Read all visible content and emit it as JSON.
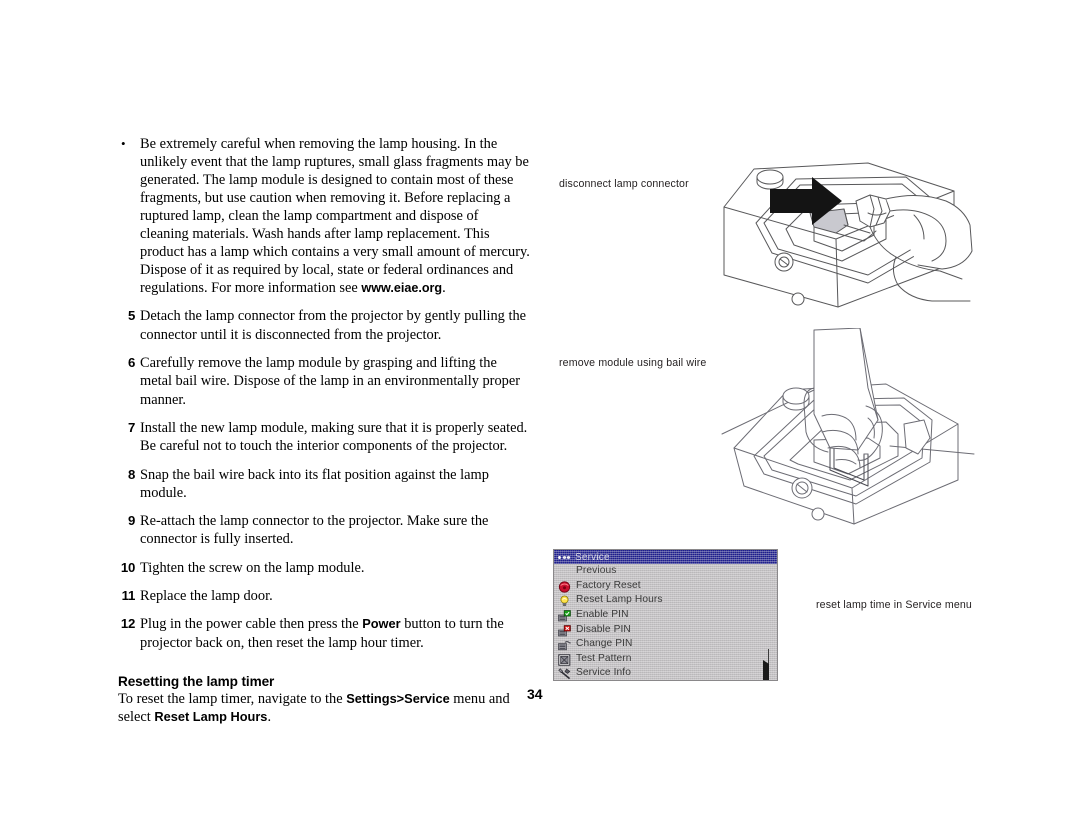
{
  "page": {
    "number": "34"
  },
  "body": {
    "bullet": {
      "marker": "•",
      "text_before_link": "Be extremely careful when removing the lamp housing. In the unlikely event that the lamp ruptures, small glass fragments may be generated. The lamp module is designed to contain most of these fragments, but use caution when removing it. Before replacing a ruptured lamp, clean the lamp compartment and dispose of cleaning materials. Wash hands after lamp replacement. This product has a lamp which contains a very small amount of mercury. Dispose of it as required by local, state or federal ordinances and regulations. For more information see ",
      "link_text": "www.eiae.org",
      "text_after_link": "."
    },
    "steps": [
      {
        "number": "5",
        "text": "Detach the lamp connector from the projector by gently pulling the connector until it is disconnected from the projector."
      },
      {
        "number": "6",
        "text": "Carefully remove the lamp module by grasping and lifting the metal bail wire. Dispose of the lamp in an environmentally proper manner."
      },
      {
        "number": "7",
        "text": "Install the new lamp module, making sure that it is properly seated. Be careful not to touch the interior components of the projector."
      },
      {
        "number": "8",
        "text": "Snap the bail wire back into its flat position against the lamp module."
      },
      {
        "number": "9",
        "text": "Re-attach the lamp connector to the projector. Make sure the connector is fully inserted."
      },
      {
        "number": "10",
        "text": "Tighten the screw on the lamp module."
      },
      {
        "number": "11",
        "text": "Replace the lamp door."
      },
      {
        "number": "12",
        "text_part1": "Plug in the power cable then press the ",
        "bold": "Power",
        "text_part2": " button to turn the projector back on, then reset the lamp hour timer."
      }
    ],
    "section": {
      "heading": "Resetting the lamp timer",
      "sentence_part1": "To reset the lamp timer, navigate to the ",
      "bold1": "Settings>Service",
      "sentence_part2": " menu and select ",
      "bold2": "Reset Lamp Hours",
      "sentence_part3": "."
    }
  },
  "figures": [
    {
      "id": "disconnect",
      "caption": "disconnect lamp connector",
      "alt": "line drawing of a hand pulling the lamp connector out of the projector, with a black arrow pointing at the connector"
    },
    {
      "id": "remove",
      "caption": "remove module using bail wire",
      "alt": "line drawing of a hand lifting the lamp module by its metal bail wire"
    },
    {
      "id": "osd",
      "caption": "reset lamp time in Service menu",
      "alt": "on-screen display of the projector Service menu"
    }
  ],
  "osd_menu": {
    "title": "Service",
    "title_bar_color": "#1d1d8f",
    "background_color": "#c4c2c4",
    "items": [
      {
        "label": "Previous",
        "icon": "none",
        "control": "none"
      },
      {
        "label": "Factory Reset",
        "icon": "reset-icon",
        "control": "none"
      },
      {
        "label": "Reset Lamp Hours",
        "icon": "lightbulb-icon",
        "control": "none"
      },
      {
        "label": "Enable PIN",
        "icon": "keypad-green-icon",
        "control": "none"
      },
      {
        "label": "Disable PIN",
        "icon": "keypad-red-icon",
        "control": "none"
      },
      {
        "label": "Change PIN",
        "icon": "keypad-icon",
        "control": "none"
      },
      {
        "label": "Test Pattern",
        "icon": "test-pattern-icon",
        "control": "checkbox"
      },
      {
        "label": "Service Info",
        "icon": "wrench-icon",
        "control": "submenu-arrow"
      }
    ]
  }
}
